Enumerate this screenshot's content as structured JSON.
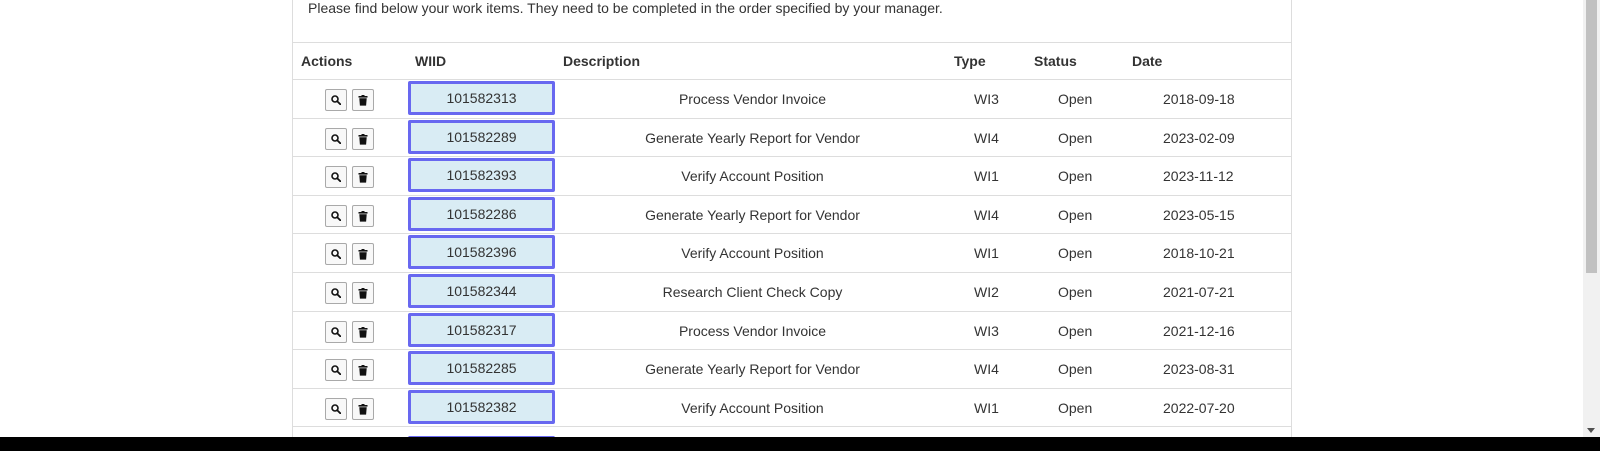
{
  "intro_text": "Please find below your work items. They need to be completed in the order specified by your manager.",
  "columns": {
    "actions": "Actions",
    "wiid": "WIID",
    "description": "Description",
    "type": "Type",
    "status": "Status",
    "date": "Date"
  },
  "icons": {
    "view": "search-icon",
    "delete": "trash-icon"
  },
  "colors": {
    "wiid_border": "#6868f0",
    "wiid_fill": "#d9ecf4"
  },
  "rows": [
    {
      "wiid": "101582313",
      "description": "Process Vendor Invoice",
      "type": "WI3",
      "status": "Open",
      "date": "2018-09-18"
    },
    {
      "wiid": "101582289",
      "description": "Generate Yearly Report for Vendor",
      "type": "WI4",
      "status": "Open",
      "date": "2023-02-09"
    },
    {
      "wiid": "101582393",
      "description": "Verify Account Position",
      "type": "WI1",
      "status": "Open",
      "date": "2023-11-12"
    },
    {
      "wiid": "101582286",
      "description": "Generate Yearly Report for Vendor",
      "type": "WI4",
      "status": "Open",
      "date": "2023-05-15"
    },
    {
      "wiid": "101582396",
      "description": "Verify Account Position",
      "type": "WI1",
      "status": "Open",
      "date": "2018-10-21"
    },
    {
      "wiid": "101582344",
      "description": "Research Client Check Copy",
      "type": "WI2",
      "status": "Open",
      "date": "2021-07-21"
    },
    {
      "wiid": "101582317",
      "description": "Process Vendor Invoice",
      "type": "WI3",
      "status": "Open",
      "date": "2021-12-16"
    },
    {
      "wiid": "101582285",
      "description": "Generate Yearly Report for Vendor",
      "type": "WI4",
      "status": "Open",
      "date": "2023-08-31"
    },
    {
      "wiid": "101582382",
      "description": "Verify Account Position",
      "type": "WI1",
      "status": "Open",
      "date": "2022-07-20"
    }
  ]
}
